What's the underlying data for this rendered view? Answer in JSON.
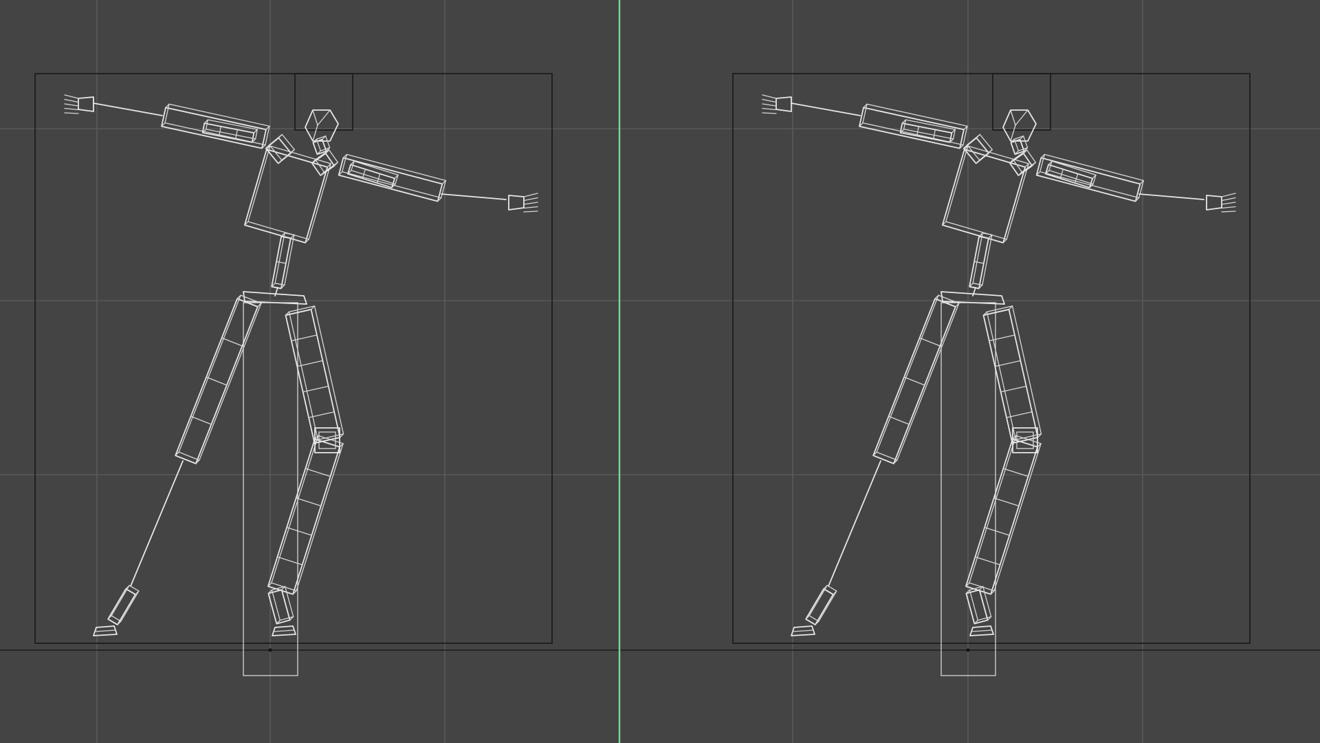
{
  "viewport": {
    "background": "#444444",
    "grid_color": "#5a5a5a",
    "divider_color": "#7fd69a",
    "wire_color": "#e8e8e8",
    "frame_color": "#1c1c1c"
  },
  "viewports": [
    {
      "id": "left",
      "content": "biped-wireframe-rig"
    },
    {
      "id": "right",
      "content": "biped-wireframe-rig"
    }
  ]
}
